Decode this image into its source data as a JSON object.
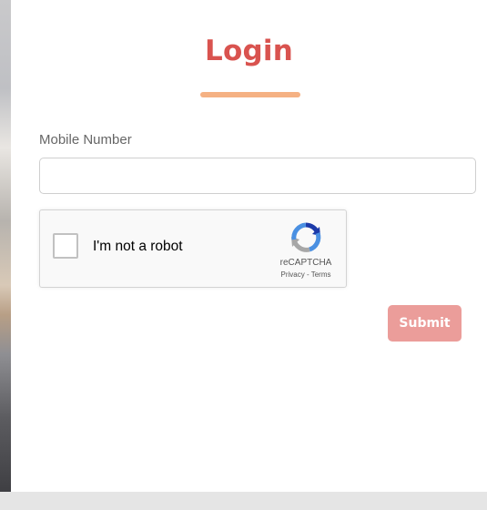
{
  "login": {
    "title": "Login",
    "mobile_label": "Mobile Number",
    "mobile_value": "",
    "mobile_placeholder": "",
    "submit_label": "Submit"
  },
  "recaptcha": {
    "label": "I'm not a robot",
    "brand": "reCAPTCHA",
    "privacy": "Privacy",
    "separator": " - ",
    "terms": "Terms",
    "logo_icon": "recaptcha-logo-icon"
  },
  "colors": {
    "title": "#d9534f",
    "underline": "#f5b183",
    "submit_bg": "#eb9d9a",
    "recaptcha_blue": "#4a90e2",
    "recaptcha_gray": "#a7a7a7"
  }
}
